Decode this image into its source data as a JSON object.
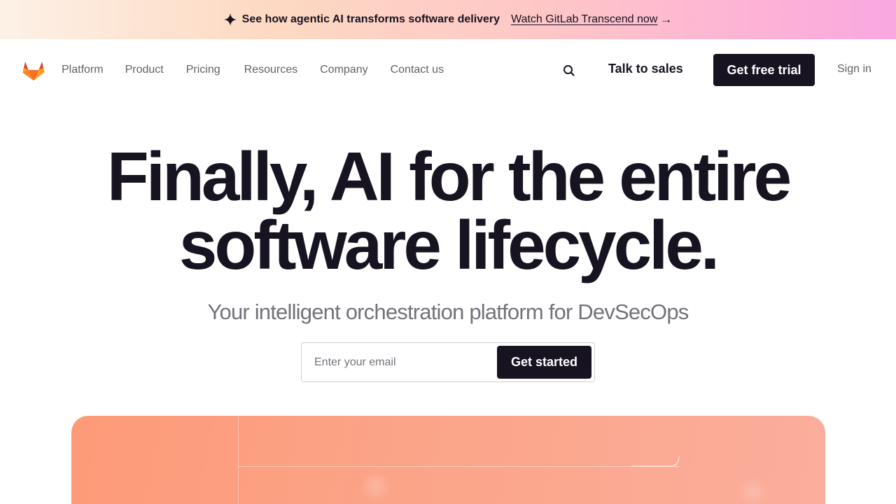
{
  "banner": {
    "headline": "See how agentic AI transforms software delivery",
    "link": "Watch GitLab Transcend now",
    "arrow": "→",
    "icon": "sparkle-icon"
  },
  "nav": {
    "logo": "gitlab-logo",
    "items": [
      "Platform",
      "Product",
      "Pricing",
      "Resources",
      "Company",
      "Contact us"
    ],
    "search_icon": "search-icon",
    "talk_to_sales": "Talk to sales",
    "free_trial": "Get free trial",
    "sign_in": "Sign in"
  },
  "hero": {
    "title_line1": "Finally, AI for the entire",
    "title_line2": "software lifecycle.",
    "subtitle": "Your intelligent orchestration platform for DevSecOps",
    "email_placeholder": "Enter your email",
    "cta": "Get started"
  },
  "colors": {
    "primary_dark": "#171321",
    "muted_text": "#74717a",
    "banner_start": "#fdf1e6",
    "banner_end": "#f9a8e0",
    "media_accent": "#fd9a78"
  }
}
